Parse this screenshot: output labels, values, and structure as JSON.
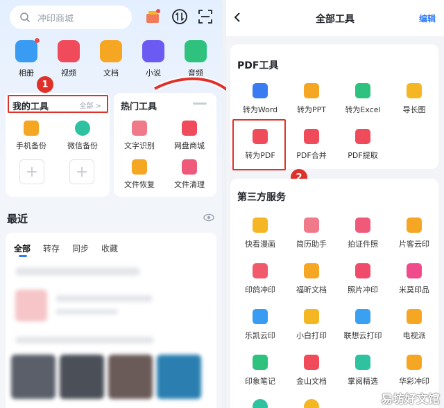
{
  "left": {
    "search_placeholder": "冲印商城",
    "apps": [
      {
        "label": "相册",
        "icon": "album-icon",
        "color": "#3a9bf2",
        "dot": true
      },
      {
        "label": "视频",
        "icon": "video-icon",
        "color": "#f04b5a",
        "dot": false
      },
      {
        "label": "文档",
        "icon": "document-icon",
        "color": "#f5a623",
        "dot": false
      },
      {
        "label": "小说",
        "icon": "novel-icon",
        "color": "#6b5bf2",
        "dot": false
      },
      {
        "label": "音频",
        "icon": "audio-icon",
        "color": "#2ec27e",
        "dot": false
      }
    ],
    "my_tools": {
      "title": "我的工具",
      "more": "全部 >",
      "items": [
        {
          "label": "手机备份",
          "color": "#f5a623"
        },
        {
          "label": "微信备份",
          "color": "#2ec2a0"
        }
      ]
    },
    "hot_tools": {
      "title": "热门工具",
      "items": [
        {
          "label": "文字识别",
          "color": "#f07a8a"
        },
        {
          "label": "网盘商城",
          "color": "#f04b5a"
        },
        {
          "label": "文件恢复",
          "color": "#f5a623"
        },
        {
          "label": "文件清理",
          "color": "#f05a7a"
        }
      ]
    },
    "recent": {
      "title": "最近",
      "tabs": [
        "全部",
        "转存",
        "同步",
        "收藏"
      ]
    }
  },
  "right": {
    "header": {
      "title": "全部工具",
      "edit": "编辑"
    },
    "pdf": {
      "title": "PDF工具",
      "items": [
        {
          "label": "转为Word",
          "color": "#3a7bf2"
        },
        {
          "label": "转为PPT",
          "color": "#f5a623"
        },
        {
          "label": "转为Excel",
          "color": "#2ec27e"
        },
        {
          "label": "导长图",
          "color": "#f5b623"
        },
        {
          "label": "转为PDF",
          "color": "#f04b5a"
        },
        {
          "label": "PDF合并",
          "color": "#f04b5a"
        },
        {
          "label": "PDF提取",
          "color": "#f04b5a"
        }
      ]
    },
    "third": {
      "title": "第三方服务",
      "items": [
        {
          "label": "快看漫画",
          "color": "#f5b623"
        },
        {
          "label": "简历助手",
          "color": "#f07a8a"
        },
        {
          "label": "拍证件照",
          "color": "#f05a7a"
        },
        {
          "label": "片客云印",
          "color": "#f5a623"
        },
        {
          "label": "印鸽冲印",
          "color": "#f05a6a"
        },
        {
          "label": "福昕文档",
          "color": "#f5a623"
        },
        {
          "label": "照片冲印",
          "color": "#f04b6a"
        },
        {
          "label": "米莫印品",
          "color": "#f04b8a"
        },
        {
          "label": "乐凯云印",
          "color": "#3a9bf2"
        },
        {
          "label": "小白打印",
          "color": "#f5b623"
        },
        {
          "label": "联想云打印",
          "color": "#3aa0f2"
        },
        {
          "label": "电视派",
          "color": "#f5a623"
        },
        {
          "label": "印象笔记",
          "color": "#2ec27e"
        },
        {
          "label": "金山文档",
          "color": "#f04b5a"
        },
        {
          "label": "掌阅精选",
          "color": "#2ec2a0"
        },
        {
          "label": "华彩冲印",
          "color": "#f5a623"
        }
      ]
    }
  },
  "annotations": {
    "badge1": "1",
    "badge2": "2"
  },
  "watermark": "易坊好文馆"
}
